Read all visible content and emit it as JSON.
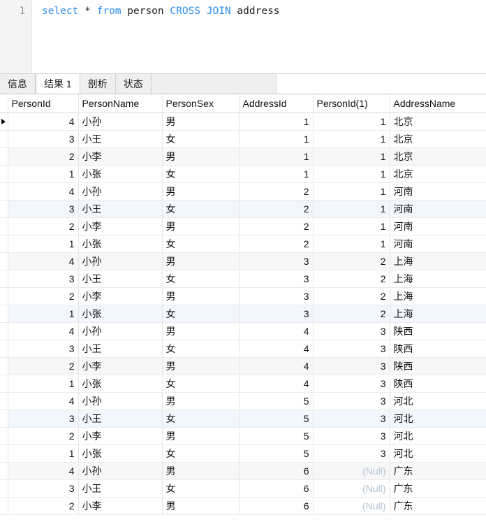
{
  "editor": {
    "line_number": "1",
    "sql_tokens": [
      {
        "text": "select",
        "type": "keyword"
      },
      {
        "text": " ",
        "type": "plain"
      },
      {
        "text": "*",
        "type": "operator"
      },
      {
        "text": " ",
        "type": "plain"
      },
      {
        "text": "from",
        "type": "keyword"
      },
      {
        "text": " ",
        "type": "plain"
      },
      {
        "text": "person",
        "type": "plain"
      },
      {
        "text": " ",
        "type": "plain"
      },
      {
        "text": "CROSS",
        "type": "keyword"
      },
      {
        "text": " ",
        "type": "plain"
      },
      {
        "text": "JOIN",
        "type": "keyword"
      },
      {
        "text": " ",
        "type": "plain"
      },
      {
        "text": "address",
        "type": "plain"
      }
    ],
    "sql_text": "select * from person CROSS JOIN address",
    "keyword_color": "#2d8cf0",
    "plain_color": "#222222"
  },
  "tabs": {
    "items": [
      {
        "label": "信息",
        "active": false
      },
      {
        "label": "结果 1",
        "active": true
      },
      {
        "label": "剖析",
        "active": false
      },
      {
        "label": "状态",
        "active": false
      }
    ]
  },
  "result_grid": {
    "selected_column": "PersonId",
    "current_row_index": 0,
    "null_label": "(Null)",
    "null_color": "#b4c4d4",
    "selected_header_color": "#d6e8f7",
    "tint_gray_color": "#f7f7f7",
    "tint_blue_color": "#f1f7fd",
    "columns": [
      {
        "key": "PersonId",
        "label": "PersonId",
        "align": "right"
      },
      {
        "key": "PersonName",
        "label": "PersonName",
        "align": "left"
      },
      {
        "key": "PersonSex",
        "label": "PersonSex",
        "align": "left"
      },
      {
        "key": "AddressId",
        "label": "AddressId",
        "align": "right"
      },
      {
        "key": "PersonId(1)",
        "label": "PersonId(1)",
        "align": "right"
      },
      {
        "key": "AddressName",
        "label": "AddressName",
        "align": "left"
      }
    ],
    "rows": [
      {
        "PersonId": "4",
        "PersonName": "小孙",
        "PersonSex": "男",
        "AddressId": "1",
        "PersonId1": "1",
        "AddressName": "北京",
        "tint": "none",
        "marker": true
      },
      {
        "PersonId": "3",
        "PersonName": "小王",
        "PersonSex": "女",
        "AddressId": "1",
        "PersonId1": "1",
        "AddressName": "北京",
        "tint": "none",
        "marker": false
      },
      {
        "PersonId": "2",
        "PersonName": "小李",
        "PersonSex": "男",
        "AddressId": "1",
        "PersonId1": "1",
        "AddressName": "北京",
        "tint": "gray",
        "marker": false
      },
      {
        "PersonId": "1",
        "PersonName": "小张",
        "PersonSex": "女",
        "AddressId": "1",
        "PersonId1": "1",
        "AddressName": "北京",
        "tint": "none",
        "marker": false
      },
      {
        "PersonId": "4",
        "PersonName": "小孙",
        "PersonSex": "男",
        "AddressId": "2",
        "PersonId1": "1",
        "AddressName": "河南",
        "tint": "none",
        "marker": false
      },
      {
        "PersonId": "3",
        "PersonName": "小王",
        "PersonSex": "女",
        "AddressId": "2",
        "PersonId1": "1",
        "AddressName": "河南",
        "tint": "blue",
        "marker": false
      },
      {
        "PersonId": "2",
        "PersonName": "小李",
        "PersonSex": "男",
        "AddressId": "2",
        "PersonId1": "1",
        "AddressName": "河南",
        "tint": "none",
        "marker": false
      },
      {
        "PersonId": "1",
        "PersonName": "小张",
        "PersonSex": "女",
        "AddressId": "2",
        "PersonId1": "1",
        "AddressName": "河南",
        "tint": "none",
        "marker": false
      },
      {
        "PersonId": "4",
        "PersonName": "小孙",
        "PersonSex": "男",
        "AddressId": "3",
        "PersonId1": "2",
        "AddressName": "上海",
        "tint": "gray",
        "marker": false
      },
      {
        "PersonId": "3",
        "PersonName": "小王",
        "PersonSex": "女",
        "AddressId": "3",
        "PersonId1": "2",
        "AddressName": "上海",
        "tint": "none",
        "marker": false
      },
      {
        "PersonId": "2",
        "PersonName": "小李",
        "PersonSex": "男",
        "AddressId": "3",
        "PersonId1": "2",
        "AddressName": "上海",
        "tint": "none",
        "marker": false
      },
      {
        "PersonId": "1",
        "PersonName": "小张",
        "PersonSex": "女",
        "AddressId": "3",
        "PersonId1": "2",
        "AddressName": "上海",
        "tint": "blue",
        "marker": false
      },
      {
        "PersonId": "4",
        "PersonName": "小孙",
        "PersonSex": "男",
        "AddressId": "4",
        "PersonId1": "3",
        "AddressName": "陕西",
        "tint": "none",
        "marker": false
      },
      {
        "PersonId": "3",
        "PersonName": "小王",
        "PersonSex": "女",
        "AddressId": "4",
        "PersonId1": "3",
        "AddressName": "陕西",
        "tint": "none",
        "marker": false
      },
      {
        "PersonId": "2",
        "PersonName": "小李",
        "PersonSex": "男",
        "AddressId": "4",
        "PersonId1": "3",
        "AddressName": "陕西",
        "tint": "gray",
        "marker": false
      },
      {
        "PersonId": "1",
        "PersonName": "小张",
        "PersonSex": "女",
        "AddressId": "4",
        "PersonId1": "3",
        "AddressName": "陕西",
        "tint": "none",
        "marker": false
      },
      {
        "PersonId": "4",
        "PersonName": "小孙",
        "PersonSex": "男",
        "AddressId": "5",
        "PersonId1": "3",
        "AddressName": "河北",
        "tint": "none",
        "marker": false
      },
      {
        "PersonId": "3",
        "PersonName": "小王",
        "PersonSex": "女",
        "AddressId": "5",
        "PersonId1": "3",
        "AddressName": "河北",
        "tint": "blue",
        "marker": false
      },
      {
        "PersonId": "2",
        "PersonName": "小李",
        "PersonSex": "男",
        "AddressId": "5",
        "PersonId1": "3",
        "AddressName": "河北",
        "tint": "none",
        "marker": false
      },
      {
        "PersonId": "1",
        "PersonName": "小张",
        "PersonSex": "女",
        "AddressId": "5",
        "PersonId1": "3",
        "AddressName": "河北",
        "tint": "none",
        "marker": false
      },
      {
        "PersonId": "4",
        "PersonName": "小孙",
        "PersonSex": "男",
        "AddressId": "6",
        "PersonId1": "(Null)",
        "AddressName": "广东",
        "tint": "gray",
        "marker": false
      },
      {
        "PersonId": "3",
        "PersonName": "小王",
        "PersonSex": "女",
        "AddressId": "6",
        "PersonId1": "(Null)",
        "AddressName": "广东",
        "tint": "none",
        "marker": false
      },
      {
        "PersonId": "2",
        "PersonName": "小李",
        "PersonSex": "男",
        "AddressId": "6",
        "PersonId1": "(Null)",
        "AddressName": "广东",
        "tint": "none",
        "marker": false
      }
    ]
  }
}
